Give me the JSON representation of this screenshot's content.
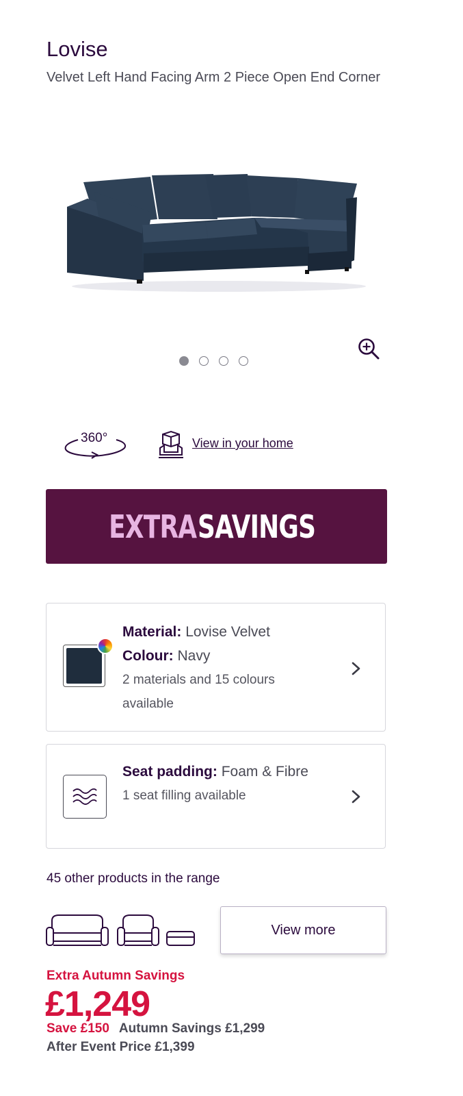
{
  "product": {
    "title": "Lovise",
    "subtitle": "Velvet Left Hand Facing Arm 2 Piece Open End Corner",
    "image_count": 4,
    "active_image": 1
  },
  "view_tools": {
    "spin_label": "360°",
    "view_in_home_label": "View in your home"
  },
  "banner": {
    "word1": "EXTRA",
    "word2": "SAVINGS"
  },
  "material_card": {
    "material_label": "Material:",
    "material_value": "Lovise Velvet",
    "colour_label": "Colour:",
    "colour_value": "Navy",
    "availability": "2 materials and 15 colours available",
    "swatch_color": "#1f2d3d"
  },
  "padding_card": {
    "label": "Seat padding:",
    "value": "Foam & Fibre",
    "availability": "1 seat filling available"
  },
  "range": {
    "text": "45 other products in the range",
    "button_label": "View more"
  },
  "pricing": {
    "promo_label": "Extra Autumn Savings",
    "price": "£1,249",
    "save": "Save £150",
    "autumn_price": "Autumn Savings £1,299",
    "after_event": "After Event Price £1,399"
  },
  "colors": {
    "brand_purple": "#561340",
    "accent_pink": "#e8b5e2",
    "sale_red": "#d5133f",
    "text_dark": "#2b0a3d"
  }
}
